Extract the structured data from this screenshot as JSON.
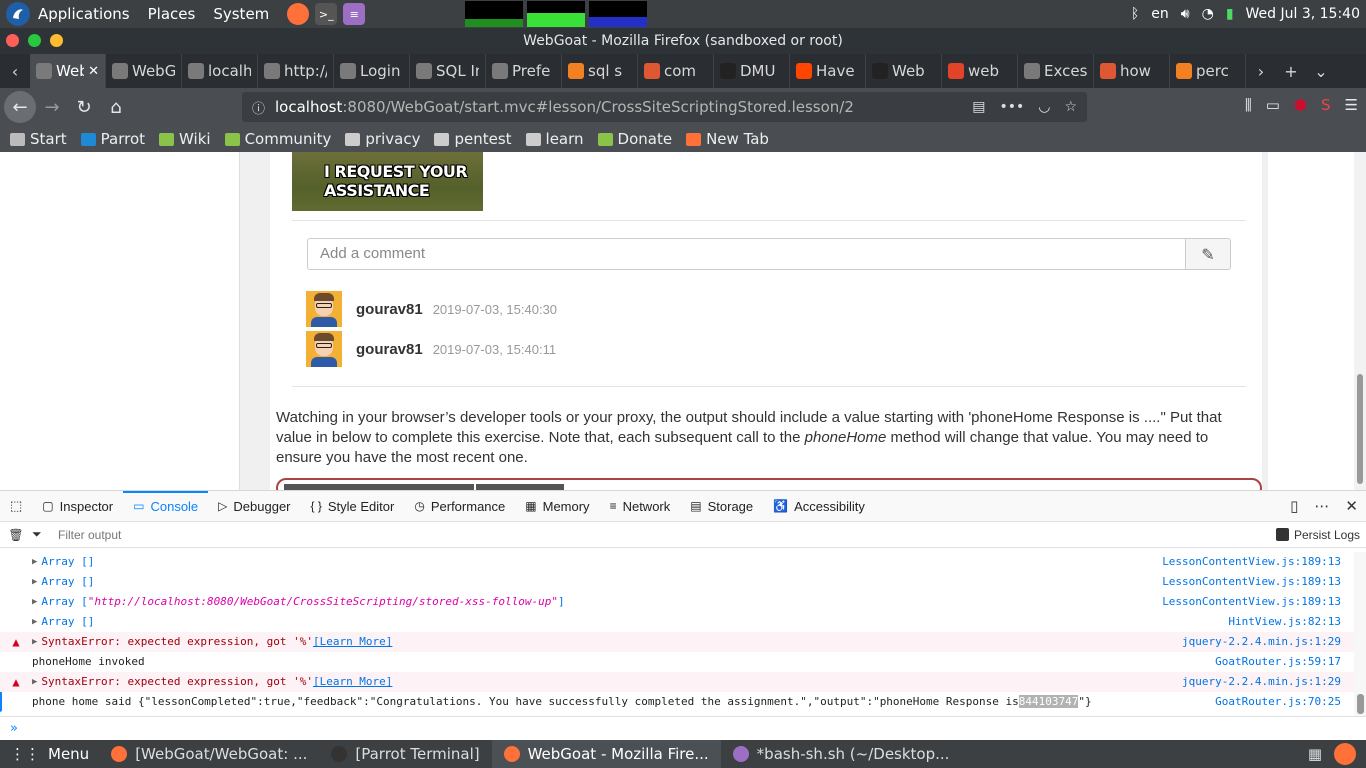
{
  "system_bar": {
    "menus": [
      "Applications",
      "Places",
      "System"
    ],
    "lang": "en",
    "datetime": "Wed Jul  3, 15:40"
  },
  "window": {
    "title": "WebGoat - Mozilla Firefox (sandboxed or root)"
  },
  "tabs": [
    {
      "label": "WebG",
      "icon": "webgoat-icon",
      "color": "#7a7a7a",
      "active": true
    },
    {
      "label": "WebGo",
      "icon": "webgoat-icon",
      "color": "#7a7a7a"
    },
    {
      "label": "localhos",
      "icon": "page-icon",
      "color": "#7a7a7a"
    },
    {
      "label": "http://lo",
      "icon": "page-icon",
      "color": "#7a7a7a"
    },
    {
      "label": "Login Pa",
      "icon": "page-icon",
      "color": "#7a7a7a"
    },
    {
      "label": "SQL Inte",
      "icon": "page-icon",
      "color": "#7a7a7a"
    },
    {
      "label": "Prefe",
      "icon": "gear-icon",
      "color": "#7a7a7a"
    },
    {
      "label": "sql s",
      "icon": "stackoverflow-icon",
      "color": "#f48024"
    },
    {
      "label": "com",
      "icon": "duckduckgo-icon",
      "color": "#de5833"
    },
    {
      "label": "DMU",
      "icon": "github-icon",
      "color": "#222222"
    },
    {
      "label": "Have",
      "icon": "reddit-icon",
      "color": "#ff4500"
    },
    {
      "label": "Web",
      "icon": "github-icon",
      "color": "#222222"
    },
    {
      "label": "web",
      "icon": "gitlab-icon",
      "color": "#e24329"
    },
    {
      "label": "Excess",
      "icon": "page-icon",
      "color": "#7a7a7a"
    },
    {
      "label": "how",
      "icon": "duckduckgo-icon",
      "color": "#de5833"
    },
    {
      "label": "perc",
      "icon": "stackoverflow-icon",
      "color": "#f48024"
    }
  ],
  "url": {
    "host": "localhost",
    "rest": ":8080/WebGoat/start.mvc#lesson/CrossSiteScriptingStored.lesson/2"
  },
  "bookmarks": [
    {
      "label": "Start",
      "color": "#bbbbbb"
    },
    {
      "label": "Parrot",
      "color": "#1e8ad6"
    },
    {
      "label": "Wiki",
      "color": "#8bc34a"
    },
    {
      "label": "Community",
      "color": "#8bc34a"
    },
    {
      "label": "privacy",
      "color": "#cccccc"
    },
    {
      "label": "pentest",
      "color": "#cccccc"
    },
    {
      "label": "learn",
      "color": "#cccccc"
    },
    {
      "label": "Donate",
      "color": "#8bc34a"
    },
    {
      "label": "New Tab",
      "color": "#ff7139"
    }
  ],
  "page": {
    "meme_text": "I REQUEST YOUR ASSISTANCE",
    "comment_placeholder": "Add a comment",
    "comments": [
      {
        "user": "gourav81",
        "date": "2019-07-03, 15:40:30"
      },
      {
        "user": "gourav81",
        "date": "2019-07-03, 15:40:11"
      }
    ],
    "instruction_pre": "Watching in your browser’s developer tools or your proxy, the output should include a value starting with 'phoneHome Response is ....\" Put that value in below to complete this exercise. Note that, each subsequent call to the ",
    "instruction_em": "phoneHome",
    "instruction_post": " method will change that value. You may need to ensure you have the most recent one."
  },
  "devtools": {
    "tabs": [
      "Inspector",
      "Console",
      "Debugger",
      "Style Editor",
      "Performance",
      "Memory",
      "Network",
      "Storage",
      "Accessibility"
    ],
    "filter_placeholder": "Filter output",
    "persist_logs": "Persist Logs",
    "log": [
      {
        "type": "log",
        "prefix": "Array []",
        "string": "",
        "suffix": "",
        "src": "LessonContentView.js:189:13"
      },
      {
        "type": "log",
        "prefix": "Array []",
        "string": "",
        "suffix": "",
        "src": "LessonContentView.js:189:13"
      },
      {
        "type": "log",
        "prefix": "Array [ ",
        "string": "\"http://localhost:8080/WebGoat/CrossSiteScripting/stored-xss-follow-up\"",
        "suffix": " ]",
        "src": "LessonContentView.js:189:13"
      },
      {
        "type": "log",
        "prefix": "Array []",
        "string": "",
        "suffix": "",
        "src": "HintView.js:82:13"
      },
      {
        "type": "error",
        "prefix": "SyntaxError: expected expression, got '%' ",
        "link": "[Learn More]",
        "src": "jquery-2.2.4.min.js:1:29"
      },
      {
        "type": "plain",
        "text": "phoneHome invoked",
        "src": "GoatRouter.js:59:17"
      },
      {
        "type": "error",
        "prefix": "SyntaxError: expected expression, got '%' ",
        "link": "[Learn More]",
        "src": "jquery-2.2.4.min.js:1:29"
      },
      {
        "type": "result",
        "text": "phone home said {\"lessonCompleted\":true,\"feedback\":\"Congratulations. You have successfully completed the assignment.\",\"output\":\"phoneHome Response is ",
        "highlight": "844103747",
        "tail": "\"}",
        "src": "GoatRouter.js:70:25"
      }
    ],
    "input_prompt": "»"
  },
  "taskbar": {
    "menu": "Menu",
    "items": [
      {
        "label": "[WebGoat/WebGoat: ...",
        "color": "#ff7139"
      },
      {
        "label": "[Parrot Terminal]",
        "color": "#333333"
      },
      {
        "label": "WebGoat - Mozilla Fire...",
        "color": "#ff7139",
        "active": true
      },
      {
        "label": "*bash-sh.sh (~/Desktop...",
        "color": "#9c6fc4"
      }
    ]
  }
}
